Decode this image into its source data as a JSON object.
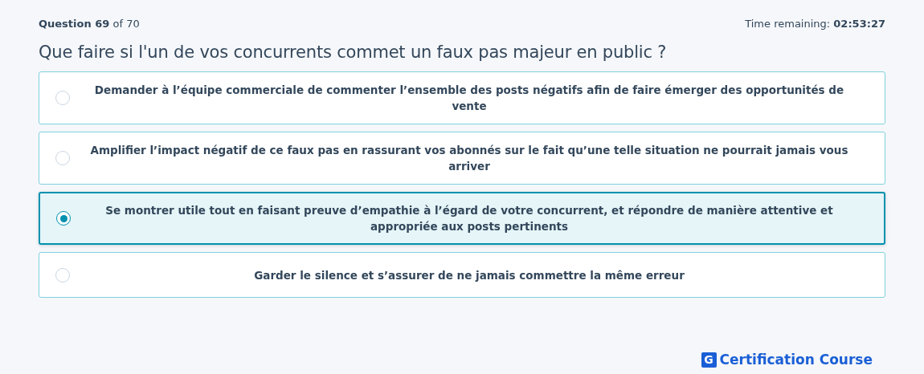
{
  "header": {
    "progress": "**Question 69** of 70",
    "timer": "Time remaining: **02:53:27**"
  },
  "question": "Que faire si l'un de vos concurrents commet un faux pas majeur en public ?",
  "options": [
    {
      "text": "Demander à l’équipe commerciale de commenter l’ensemble des posts négatifs afin de faire émerger des opportunités de vente",
      "selected": false
    },
    {
      "text": "Amplifier l’impact négatif de ce faux pas en rassurant vos abonnés sur le fait qu’une telle situation ne pourrait jamais vous arriver",
      "selected": false
    },
    {
      "text": "Se montrer utile tout en faisant preuve d’empathie à l’égard de votre concurrent, et répondre de manière attentive et appropriée aux posts pertinents",
      "selected": true
    },
    {
      "text": "Garder le silence et s’assurer de ne jamais commettre la même erreur",
      "selected": false
    }
  ],
  "brand": {
    "mark": "G",
    "name": "Certification Course"
  }
}
